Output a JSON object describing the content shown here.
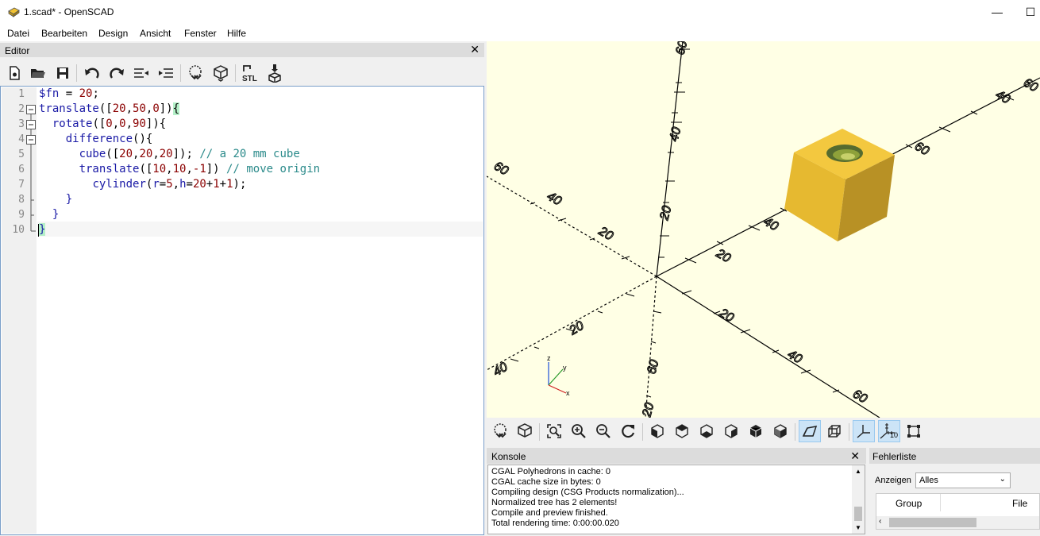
{
  "window": {
    "title": "1.scad* - OpenSCAD",
    "minimize": "—",
    "maximize": "☐"
  },
  "menu": [
    "Datei",
    "Bearbeiten",
    "Design",
    "Ansicht",
    "Fenster",
    "Hilfe"
  ],
  "editor": {
    "title": "Editor",
    "close": "✕",
    "line_numbers": [
      "1",
      "2",
      "3",
      "4",
      "5",
      "6",
      "7",
      "8",
      "9",
      "10"
    ]
  },
  "viewport": {
    "axis_labels": [
      "60",
      "40",
      "20",
      "20",
      "40",
      "60",
      "20",
      "40",
      "60",
      "20",
      "40",
      "60",
      "20",
      "40",
      "60",
      "20",
      "40",
      "60"
    ],
    "gizmo": {
      "z": "z",
      "y": "y",
      "x": "x"
    }
  },
  "view_toolbar": {
    "scale_label": "10"
  },
  "console": {
    "title": "Konsole",
    "close": "✕",
    "lines": [
      "CGAL Polyhedrons in cache: 0",
      "CGAL cache size in bytes: 0",
      "Compiling design (CSG Products normalization)...",
      "Normalized tree has 2 elements!",
      "Compile and preview finished.",
      "Total rendering time: 0:00:00.020"
    ]
  },
  "errors": {
    "title": "Fehlerliste",
    "filter_label": "Anzeigen",
    "filter_value": "Alles",
    "col_group": "Group",
    "col_file": "File"
  },
  "colors": {
    "viewport_bg": "#ffffe5",
    "cube_top": "#f3c83f",
    "cube_front": "#e6b930",
    "cube_side": "#b89125",
    "keyword": "#1a1aa6",
    "number": "#8b0000",
    "comment": "#2a8a8a"
  }
}
